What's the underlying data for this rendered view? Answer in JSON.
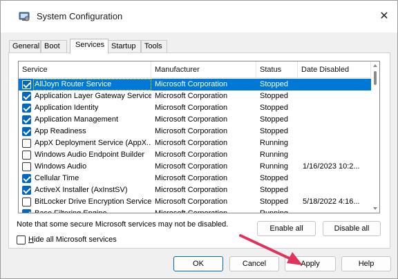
{
  "window": {
    "title": "System Configuration",
    "close_glyph": "✕"
  },
  "tabs": [
    {
      "label": "General"
    },
    {
      "label": "Boot"
    },
    {
      "label": "Services",
      "active": true
    },
    {
      "label": "Startup"
    },
    {
      "label": "Tools"
    }
  ],
  "columns": {
    "service": "Service",
    "manufacturer": "Manufacturer",
    "status": "Status",
    "date_disabled": "Date Disabled"
  },
  "rows": [
    {
      "service": "AllJoyn Router Service",
      "manufacturer": "Microsoft Corporation",
      "status": "Stopped",
      "date_disabled": "",
      "checked": true,
      "selected": true
    },
    {
      "service": "Application Layer Gateway Service",
      "manufacturer": "Microsoft Corporation",
      "status": "Stopped",
      "date_disabled": "",
      "checked": true
    },
    {
      "service": "Application Identity",
      "manufacturer": "Microsoft Corporation",
      "status": "Stopped",
      "date_disabled": "",
      "checked": true
    },
    {
      "service": "Application Management",
      "manufacturer": "Microsoft Corporation",
      "status": "Stopped",
      "date_disabled": "",
      "checked": true
    },
    {
      "service": "App Readiness",
      "manufacturer": "Microsoft Corporation",
      "status": "Stopped",
      "date_disabled": "",
      "checked": true
    },
    {
      "service": "AppX Deployment Service (AppX...",
      "manufacturer": "Microsoft Corporation",
      "status": "Running",
      "date_disabled": "",
      "checked": false
    },
    {
      "service": "Windows Audio Endpoint Builder",
      "manufacturer": "Microsoft Corporation",
      "status": "Running",
      "date_disabled": "",
      "checked": false
    },
    {
      "service": "Windows Audio",
      "manufacturer": "Microsoft Corporation",
      "status": "Running",
      "date_disabled": "1/16/2023 10:2...",
      "checked": false
    },
    {
      "service": "Cellular Time",
      "manufacturer": "Microsoft Corporation",
      "status": "Stopped",
      "date_disabled": "",
      "checked": true
    },
    {
      "service": "ActiveX Installer (AxInstSV)",
      "manufacturer": "Microsoft Corporation",
      "status": "Stopped",
      "date_disabled": "",
      "checked": true
    },
    {
      "service": "BitLocker Drive Encryption Service",
      "manufacturer": "Microsoft Corporation",
      "status": "Stopped",
      "date_disabled": "5/18/2022 4:16...",
      "checked": false
    },
    {
      "service": "Base Filtering Engine",
      "manufacturer": "Microsoft Corporation",
      "status": "Running",
      "date_disabled": "",
      "checked": true
    }
  ],
  "note": "Note that some secure Microsoft services may not be disabled.",
  "buttons": {
    "enable_all": "Enable all",
    "disable_all": "Disable all",
    "ok": "OK",
    "cancel": "Cancel",
    "apply": "Apply",
    "help": "Help"
  },
  "hide_ms": {
    "label": "Hide all Microsoft services",
    "checked": false
  },
  "colors": {
    "selection": "#0078d7",
    "checkbox_checked": "#0067c0",
    "annotation_arrow": "#e0325a"
  }
}
